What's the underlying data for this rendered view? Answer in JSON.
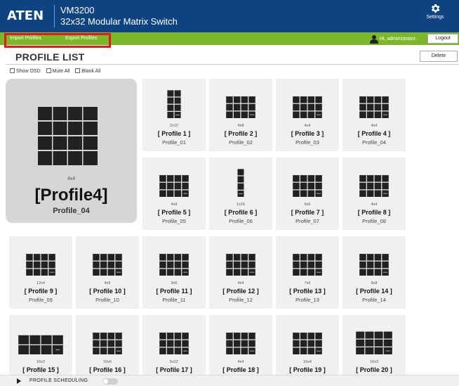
{
  "header": {
    "logo": "ATEN",
    "model": "VM3200",
    "subtitle": "32x32 Modular Matrix Switch",
    "settings_label": "Settings"
  },
  "toolbar": {
    "import_label": "Import Profiles",
    "export_label": "Export Profiles",
    "greeting": "Hi, administrator.",
    "logout_label": "Logout"
  },
  "page": {
    "title": "PROFILE LIST",
    "delete_label": "Delete"
  },
  "options": [
    {
      "label": "Show OSD",
      "checked": false
    },
    {
      "label": "Mute All",
      "checked": false
    },
    {
      "label": "Blank All",
      "checked": false
    }
  ],
  "selected_profile": {
    "layout": "4x4",
    "name": "[Profile4]",
    "sub": "Profile_04"
  },
  "profiles": [
    {
      "layout": "2x12",
      "name": "[ Profile 1 ]",
      "sub": "Profile_01"
    },
    {
      "layout": "4x8",
      "name": "[ Profile 2 ]",
      "sub": "Profile_02"
    },
    {
      "layout": "4x4",
      "name": "[ Profile 3 ]",
      "sub": "Profile_03"
    },
    {
      "layout": "4x4",
      "name": "[ Profile 4 ]",
      "sub": "Profile_04"
    },
    {
      "layout": "4x9",
      "name": "[ Profile 5 ]",
      "sub": "Profile_05"
    },
    {
      "layout": "1x16",
      "name": "[ Profile 6 ]",
      "sub": "Profile_06"
    },
    {
      "layout": "6x6",
      "name": "[ Profile 7 ]",
      "sub": "Profile_07"
    },
    {
      "layout": "4x4",
      "name": "[ Profile 8 ]",
      "sub": "Profile_08"
    },
    {
      "layout": "12x4",
      "name": "[ Profile 9 ]",
      "sub": "Profile_09"
    },
    {
      "layout": "4x9",
      "name": "[ Profile 10 ]",
      "sub": "Profile_10"
    },
    {
      "layout": "9x6",
      "name": "[ Profile 11 ]",
      "sub": "Profile_11"
    },
    {
      "layout": "4x4",
      "name": "[ Profile 12 ]",
      "sub": "Profile_12"
    },
    {
      "layout": "7x6",
      "name": "[ Profile 13 ]",
      "sub": "Profile_13"
    },
    {
      "layout": "8x8",
      "name": "[ Profile 14 ]",
      "sub": "Profile_14"
    },
    {
      "layout": "16x2",
      "name": "[ Profile 15 ]",
      "sub": ""
    },
    {
      "layout": "10x6",
      "name": "[ Profile 16 ]",
      "sub": ""
    },
    {
      "layout": "5x12",
      "name": "[ Profile 17 ]",
      "sub": ""
    },
    {
      "layout": "4x4",
      "name": "[ Profile 18 ]",
      "sub": ""
    },
    {
      "layout": "16x4",
      "name": "[ Profile 19 ]",
      "sub": ""
    },
    {
      "layout": "16x3",
      "name": "[ Profile 20 ]",
      "sub": ""
    }
  ],
  "scheduling": {
    "label": "PROFILE SCHEDULING",
    "enabled": false
  },
  "colors": {
    "header_bg": "#0d4380",
    "toolbar_bg": "#7cb72a",
    "highlight": "#e11a1a",
    "tile": "#222222"
  }
}
